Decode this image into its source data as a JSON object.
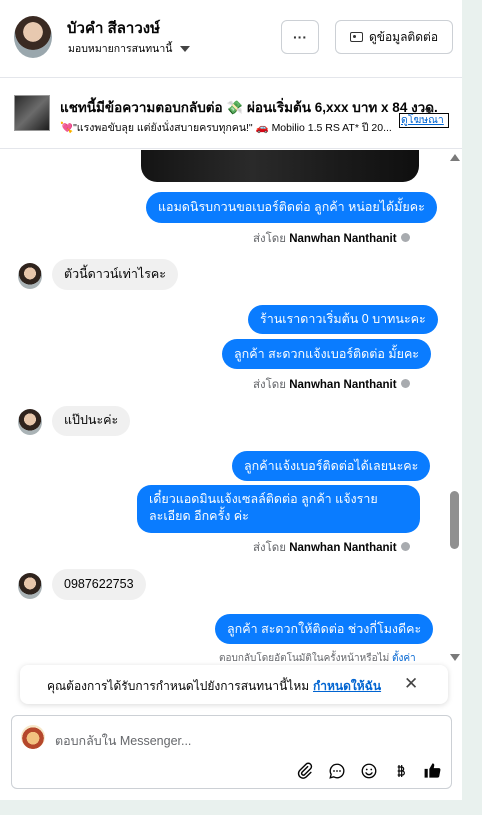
{
  "header": {
    "name": "บัวคำ สีลาวงษ์",
    "assign_label": "มอบหมายการสนทนานี้",
    "more_label": "···",
    "contact_button": "ดูข้อมูลติดต่อ"
  },
  "ad": {
    "title": "แชทนี้มีข้อความตอบกลับต่อ 💸 ผ่อนเริ่มต้น 6,xxx บาท x 84 งวด.",
    "description": "💘\"แรงพอขับลุย แต่ยังนั่งสบายครบทุกคน!\" 🚗 Mobilio 1.5 RS AT* ปี 20...",
    "close": "✕",
    "link": "ดูโฆษณา"
  },
  "messages": [
    {
      "dir": "out",
      "text": "แอมดนิรบกวนขอเบอร์ติดต่อ ลูกค้า หน่อยได้มั้ยคะ"
    },
    {
      "dir": "in",
      "text": "ตัวนี้ดาวน์เท่าไรคะ"
    },
    {
      "dir": "out",
      "text": "ร้านเราดาวเริ่มต้น 0 บาทนะคะ"
    },
    {
      "dir": "out",
      "text": "ลูกค้า สะดวกแจ้งเบอร์ติดต่อ มั้ยคะ"
    },
    {
      "dir": "in",
      "text": "แป๊ปนะค่ะ"
    },
    {
      "dir": "out",
      "text": "ลูกค้าแจ้งเบอร์ติดต่อได้เลยนะคะ"
    },
    {
      "dir": "out",
      "text": "เดี๋ยวแอดมินแจ้งเซลล์ติดต่อ ลูกค้า แจ้งรายละเอียด อีกครั้ง ค่ะ"
    },
    {
      "dir": "in",
      "text": "0987622753"
    },
    {
      "dir": "out",
      "text": "ลูกค้า สะดวกให้ติดต่อ ช่วงกี่โมงดีคะ"
    }
  ],
  "sent_by": {
    "prefix": "ส่งโดย",
    "name": "Nanwhan Nanthanit"
  },
  "auto_reply": {
    "text": "ตอบกลับโดยอัตโนมัติในครั้งหน้าหรือไม่",
    "link": "ตั้งค่า"
  },
  "prompt": {
    "text": "คุณต้องการได้รับการกำหนดไปยังการสนทนานี้ไหม",
    "link": "กำหนดให้ฉัน",
    "close": "✕"
  },
  "composer": {
    "placeholder": "ตอบกลับใน Messenger..."
  },
  "colors": {
    "outgoing_bubble": "#0a7cff",
    "incoming_bubble": "#f0f0f0",
    "link": "#0064d1"
  }
}
